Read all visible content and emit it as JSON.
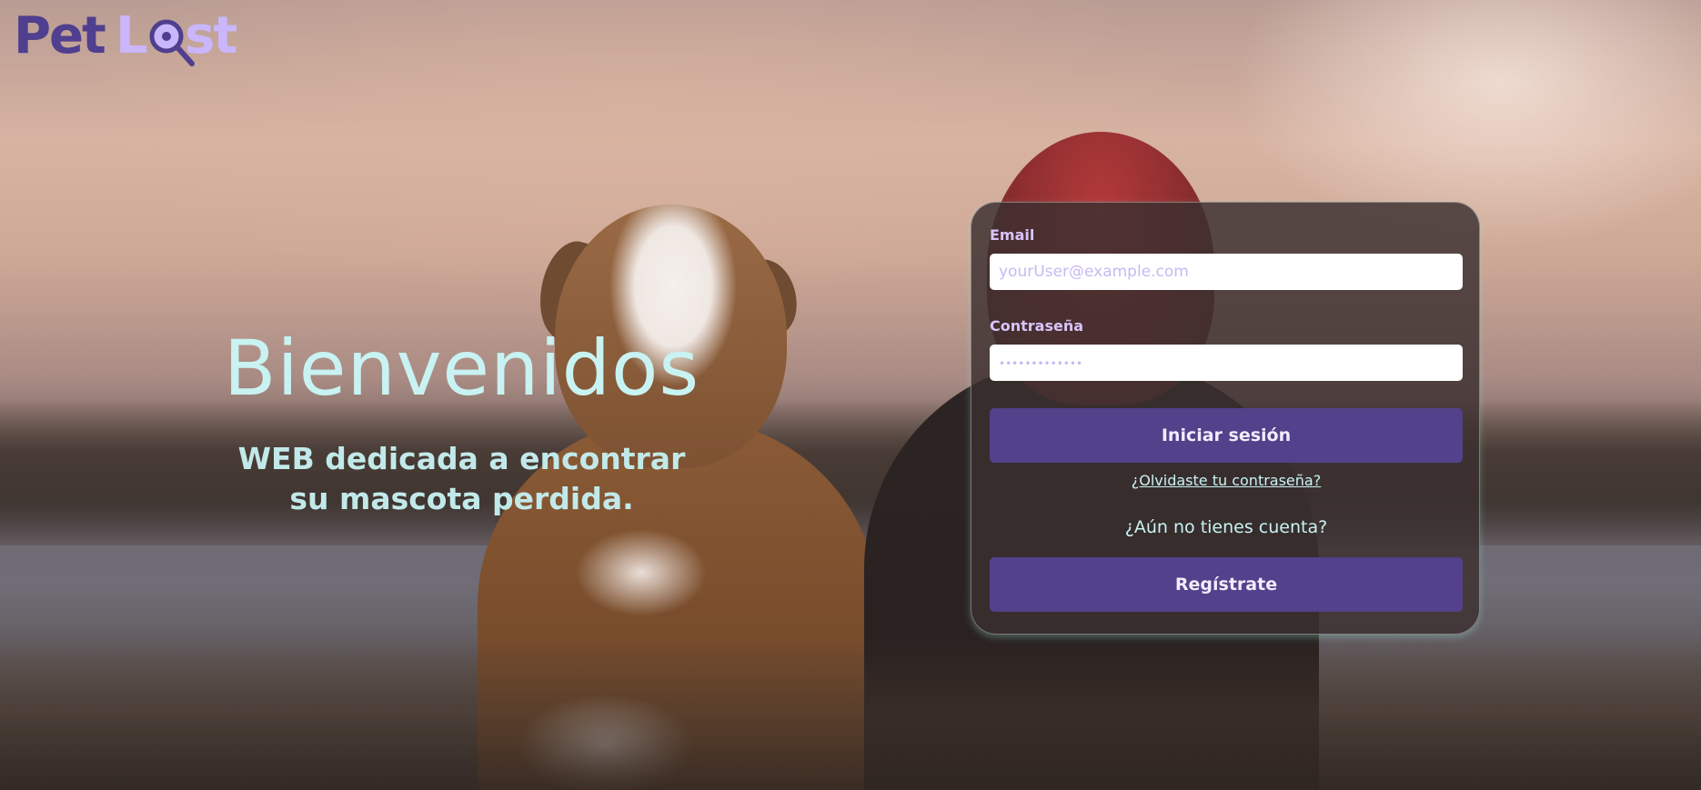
{
  "brand": {
    "logo_text": "PetLost"
  },
  "hero": {
    "title": "Bienvenidos",
    "subtitle": "WEB dedicada a encontrar su mascota perdida."
  },
  "login": {
    "email_label": "Email",
    "email_placeholder": "yourUser@example.com",
    "password_label": "Contraseña",
    "password_placeholder": "•••••••••••••",
    "login_button": "Iniciar sesión",
    "forgot_link": "¿Olvidaste tu contraseña?",
    "no_account_text": "¿Aún no tienes cuenta?",
    "register_button": "Regístrate"
  },
  "colors": {
    "accent": "#53418b",
    "logo_dark": "#4f3f8e",
    "logo_light": "#c9b6fb",
    "hero_text": "#c8f3f2",
    "label_text": "#d8c4fb"
  }
}
